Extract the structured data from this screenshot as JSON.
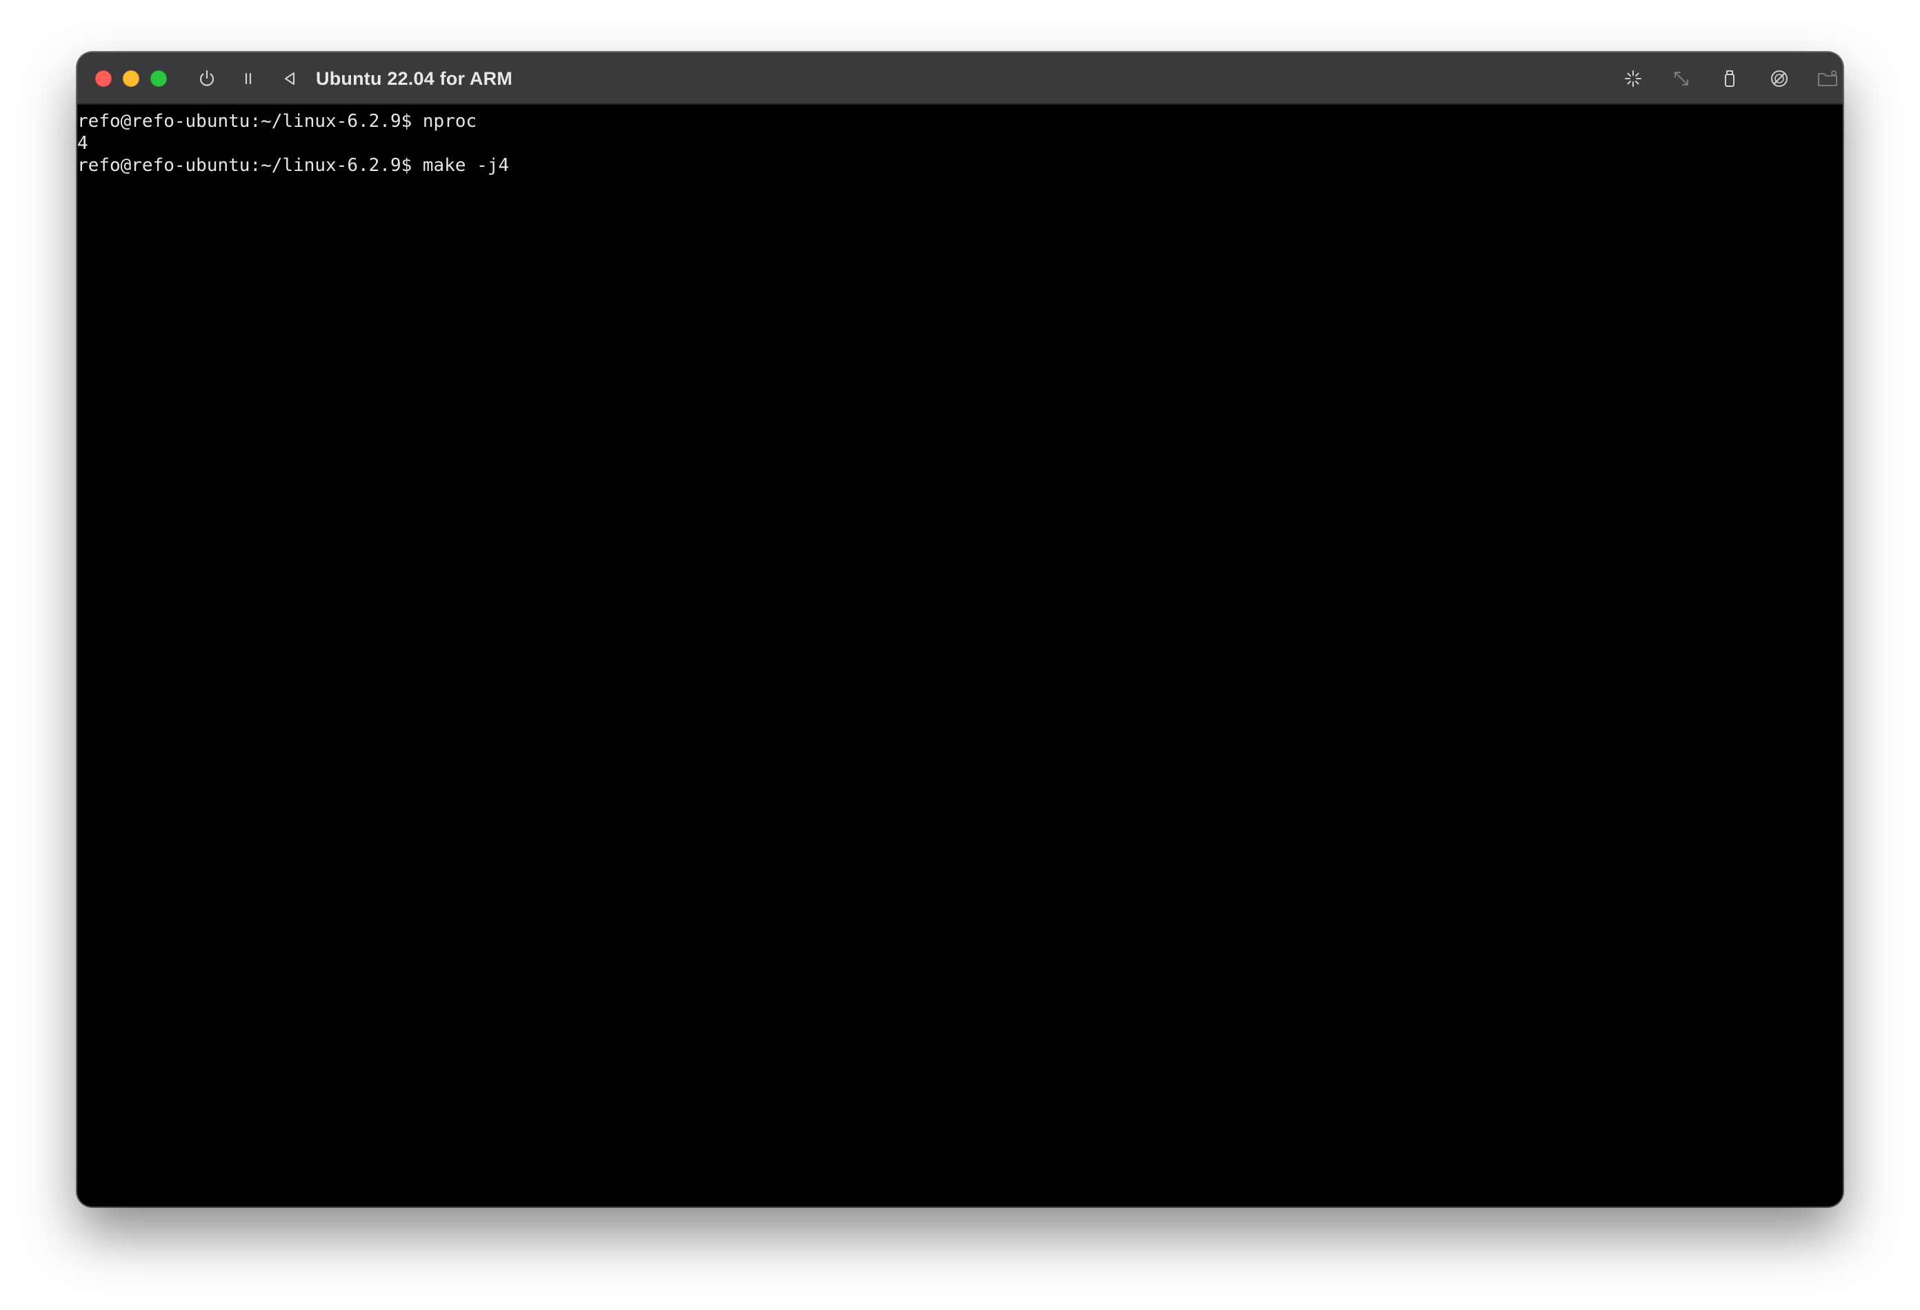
{
  "window": {
    "title": "Ubuntu 22.04 for ARM"
  },
  "toolbar": {
    "left_icons": [
      "power-icon",
      "pause-icon",
      "back-icon"
    ],
    "right_icons": [
      "sparkle-icon",
      "resize-icon",
      "usb-icon",
      "pointer-capture-icon",
      "shared-folder-icon",
      "display-windows-icon"
    ]
  },
  "terminal": {
    "lines": [
      "refo@refo-ubuntu:~/linux-6.2.9$ nproc",
      "4",
      "refo@refo-ubuntu:~/linux-6.2.9$ make -j4"
    ]
  },
  "colors": {
    "titlebar": "#3a3a3c",
    "terminal_bg": "#000000",
    "terminal_fg": "#e6e6e6",
    "close": "#ff5f57",
    "minimize": "#febc2e",
    "maximize": "#28c840"
  }
}
